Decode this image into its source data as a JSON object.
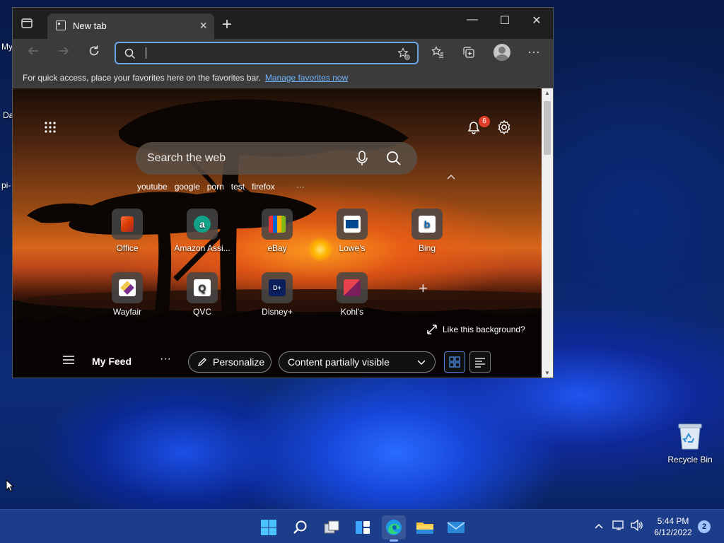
{
  "desktop": {
    "labels": [
      "My",
      "Da",
      "pi-"
    ],
    "recycle_bin_label": "Recycle Bin"
  },
  "browser": {
    "tab": {
      "title": "New tab",
      "close": "×"
    },
    "new_tab": "+",
    "window_controls": {
      "minimize": "—",
      "maximize": "☐",
      "close": "✕"
    },
    "address": {
      "value": "",
      "placeholder": ""
    },
    "favorites_bar": {
      "message": "For quick access, place your favorites here on the favorites bar.",
      "link": "Manage favorites now"
    },
    "more_menu": "···"
  },
  "new_tab_page": {
    "notification_count": "6",
    "search_placeholder": "Search the web",
    "trending": [
      "youtube",
      "google",
      "porn",
      "test",
      "firefox"
    ],
    "trending_more": "···",
    "quick_links": [
      {
        "label": "Office",
        "icon": "office-icon",
        "color": "#d83b01",
        "glyph": "▯"
      },
      {
        "label": "Amazon Assi...",
        "icon": "amazon-assistant-icon",
        "color": "#11a389",
        "glyph": "a"
      },
      {
        "label": "eBay",
        "icon": "ebay-icon",
        "color": "#2b2b2b",
        "glyph": "🛍"
      },
      {
        "label": "Lowe's",
        "icon": "lowes-icon",
        "color": "#004990",
        "glyph": "L"
      },
      {
        "label": "Bing",
        "icon": "bing-icon",
        "color": "#0f6cbd",
        "glyph": "b"
      },
      {
        "label": "Wayfair",
        "icon": "wayfair-icon",
        "color": "#7b2d8e",
        "glyph": "◆"
      },
      {
        "label": "QVC",
        "icon": "qvc-icon",
        "color": "#ffffff",
        "glyph": "Q"
      },
      {
        "label": "Disney+",
        "icon": "disney-plus-icon",
        "color": "#0b1f5c",
        "glyph": "D+"
      },
      {
        "label": "Kohl's",
        "icon": "kohls-icon",
        "color": "#a61e4d",
        "glyph": "K"
      }
    ],
    "add_shortcut": "+",
    "like_background": "Like this background?",
    "feed": {
      "menu": "≡",
      "title": "My Feed",
      "more": "···",
      "personalize": "Personalize",
      "content_visibility": "Content partially visible"
    }
  },
  "taskbar": {
    "clock_time": "5:44 PM",
    "clock_date": "6/12/2022",
    "notification_count": "2",
    "apps": [
      "start-icon",
      "search-icon",
      "task-view-icon",
      "widgets-icon",
      "edge-icon",
      "file-explorer-icon",
      "mail-icon"
    ]
  },
  "colors": {
    "accent": "#6aa7e8",
    "link": "#6fb3ff",
    "badge": "#e0402b",
    "taskbar": "#1c3d8a"
  }
}
